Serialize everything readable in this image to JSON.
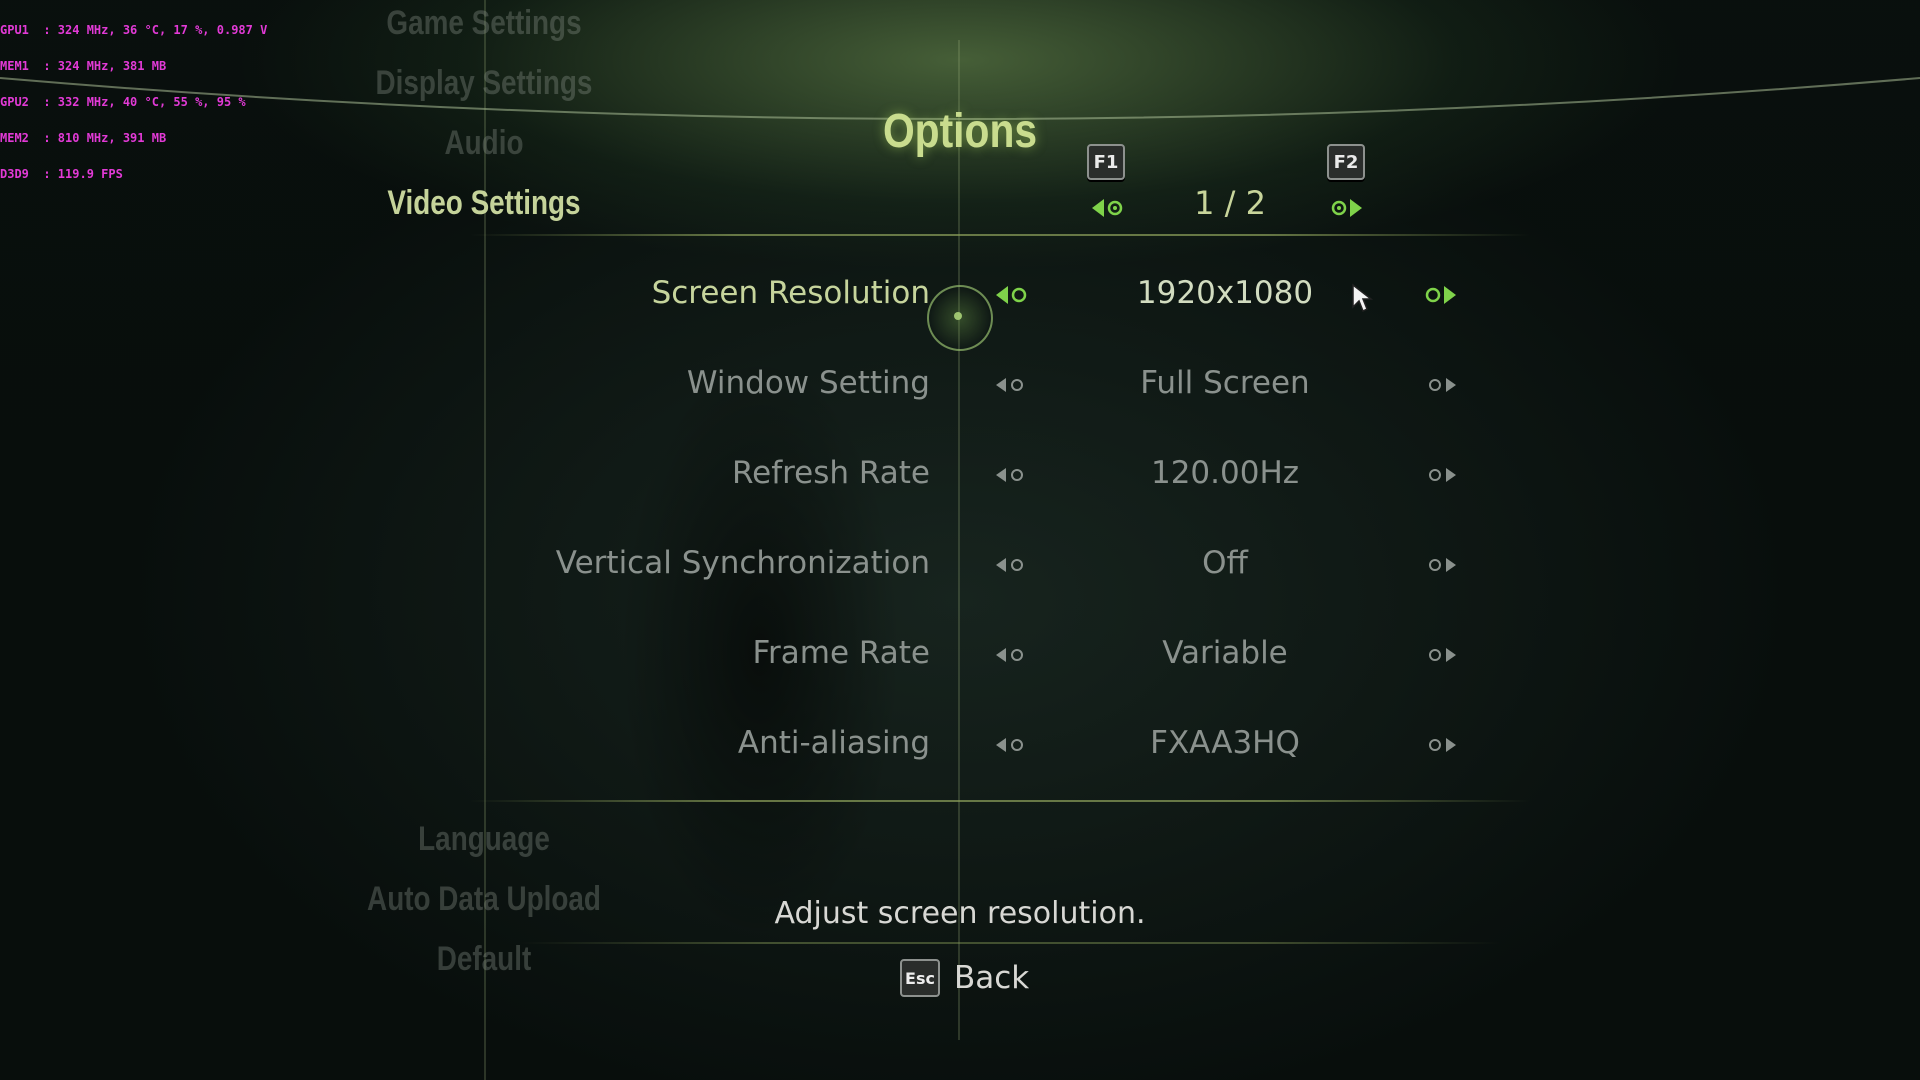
{
  "osd": {
    "lines": [
      "GPU1  : 324 MHz, 36 °C, 17 %, 0.987 V",
      "MEM1  : 324 MHz, 381 MB",
      "GPU2  : 332 MHz, 40 °C, 55 %, 95 %",
      "MEM2  : 810 MHz, 391 MB",
      "D3D9  : 119.9 FPS"
    ]
  },
  "sidebar": {
    "items": [
      {
        "label": "Game Settings"
      },
      {
        "label": "Display Settings"
      },
      {
        "label": "Audio"
      },
      {
        "label": "Video Settings"
      },
      {
        "label": "Language"
      },
      {
        "label": "Auto Data Upload"
      },
      {
        "label": "Default"
      }
    ]
  },
  "header": {
    "title": "Options",
    "prev_key": "F1",
    "next_key": "F2",
    "page": "1 / 2"
  },
  "settings": {
    "rows": [
      {
        "label": "Screen Resolution",
        "value": "1920x1080"
      },
      {
        "label": "Window Setting",
        "value": "Full Screen"
      },
      {
        "label": "Refresh Rate",
        "value": "120.00Hz"
      },
      {
        "label": "Vertical Synchronization",
        "value": "Off"
      },
      {
        "label": "Frame Rate",
        "value": "Variable"
      },
      {
        "label": "Anti-aliasing",
        "value": "FXAA3HQ"
      }
    ]
  },
  "description": "Adjust screen resolution.",
  "footer": {
    "back_key": "Esc",
    "back_label": "Back"
  },
  "colors": {
    "accent": "#c9dc8e",
    "arrow_active": "#7fd34a",
    "text_dim": "#8a918d"
  }
}
